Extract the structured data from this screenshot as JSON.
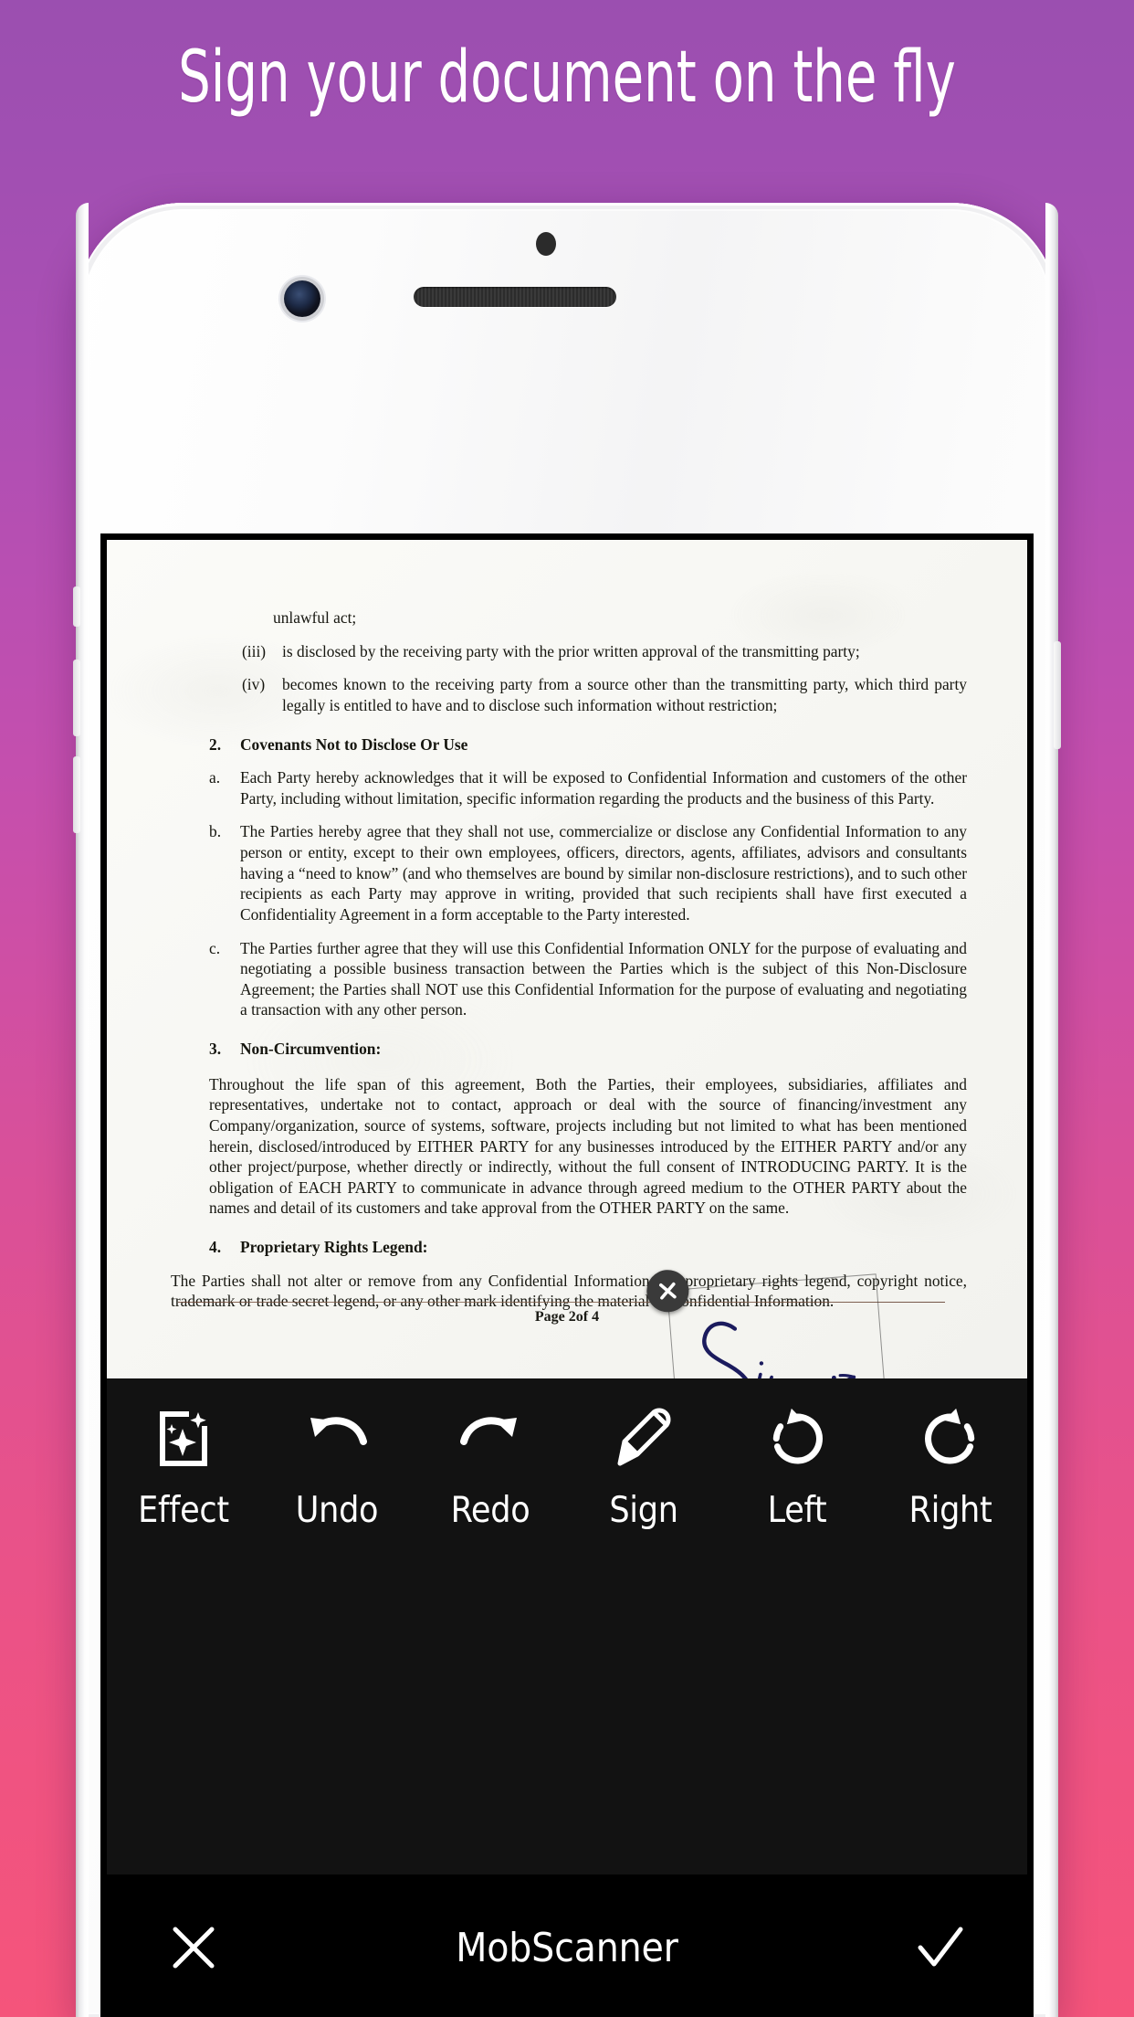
{
  "headline": "Sign your document on the fly",
  "brand_colors": {
    "gradient_top": "#9b4fb0",
    "gradient_bottom": "#f5547b",
    "toolbar_bg": "#121212",
    "bottombar_bg": "#000000",
    "ink": "#1b1b5e"
  },
  "document": {
    "paragraphs": [
      {
        "id": "p-unlawful",
        "style": "indent",
        "mark": "",
        "text": "unlawful act;"
      },
      {
        "id": "p-iii",
        "style": "roman",
        "mark": "(iii)",
        "text": "is disclosed by the receiving party with the prior written approval of the transmitting party;"
      },
      {
        "id": "p-iv",
        "style": "roman",
        "mark": "(iv)",
        "text": "becomes known to the receiving party from a source other than the transmitting party, which third party legally is entitled to have and to disclose such information without restriction;"
      },
      {
        "id": "p-h2",
        "style": "heading",
        "mark": "2.",
        "text": "Covenants Not to Disclose Or Use"
      },
      {
        "id": "p-a",
        "style": "alpha",
        "mark": "a.",
        "text": "Each Party hereby acknowledges that it will be exposed to Confidential Information and customers of the other Party, including without limitation, specific information regarding the products and the business of this Party."
      },
      {
        "id": "p-b",
        "style": "alpha",
        "mark": "b.",
        "text": "The Parties hereby agree that they shall not use, commercialize or disclose any Confidential Information to any person or entity, except to their own employees, officers, directors, agents, affiliates, advisors and consultants having a “need to know” (and who themselves are bound by similar non-disclosure restrictions), and to such other recipients as each Party may approve in writing, provided that such recipients shall have first executed a Confidentiality Agreement in a form acceptable to the Party interested."
      },
      {
        "id": "p-c",
        "style": "alpha",
        "mark": "c.",
        "text": "The Parties further agree that they will use this Confidential Information ONLY for the purpose of evaluating and negotiating a possible business transaction between the Parties which is the subject of this Non-Disclosure Agreement; the Parties shall NOT use this Confidential Information for the purpose of evaluating and negotiating a transaction with any other person."
      },
      {
        "id": "p-h3",
        "style": "heading",
        "mark": "3.",
        "text": "Non-Circumvention:"
      },
      {
        "id": "p-3body",
        "style": "plain",
        "mark": "",
        "text": "Throughout the life span of this agreement, Both the Parties, their employees, subsidiaries, affiliates and representatives, undertake not to contact, approach or deal with the source of financing/investment any Company/organization, source of systems, software, projects including but not limited to what has been mentioned herein, disclosed/introduced by EITHER PARTY for any businesses introduced by the EITHER PARTY and/or any other project/purpose, whether directly or indirectly, without the full consent of INTRODUCING PARTY. It is the obligation of EACH PARTY to communicate in advance through agreed medium to the OTHER PARTY about the names and detail of its customers and take approval from the OTHER PARTY on the same."
      },
      {
        "id": "p-h4",
        "style": "heading",
        "mark": "4.",
        "text": "Proprietary Rights Legend:"
      },
      {
        "id": "p-4body",
        "style": "flush",
        "mark": "",
        "text": "The Parties shall not alter or remove from any Confidential Information any proprietary rights legend, copyright notice, trademark or trade secret legend, or any other mark identifying the material as Confidential Information."
      }
    ],
    "page_label": "Page 2of 4"
  },
  "signature": {
    "alt": "handwritten signature reading Sign",
    "close_icon": "close-icon"
  },
  "toolbar": {
    "items": [
      {
        "id": "effect",
        "label": "Effect",
        "icon": "magic-document-icon"
      },
      {
        "id": "undo",
        "label": "Undo",
        "icon": "undo-arrow-icon"
      },
      {
        "id": "redo",
        "label": "Redo",
        "icon": "redo-arrow-icon"
      },
      {
        "id": "sign",
        "label": "Sign",
        "icon": "pencil-icon"
      },
      {
        "id": "left",
        "label": "Left",
        "icon": "rotate-left-icon"
      },
      {
        "id": "right",
        "label": "Right",
        "icon": "rotate-right-icon"
      }
    ]
  },
  "bottombar": {
    "cancel_icon": "close-x-icon",
    "title": "MobScanner",
    "confirm_icon": "check-icon"
  }
}
